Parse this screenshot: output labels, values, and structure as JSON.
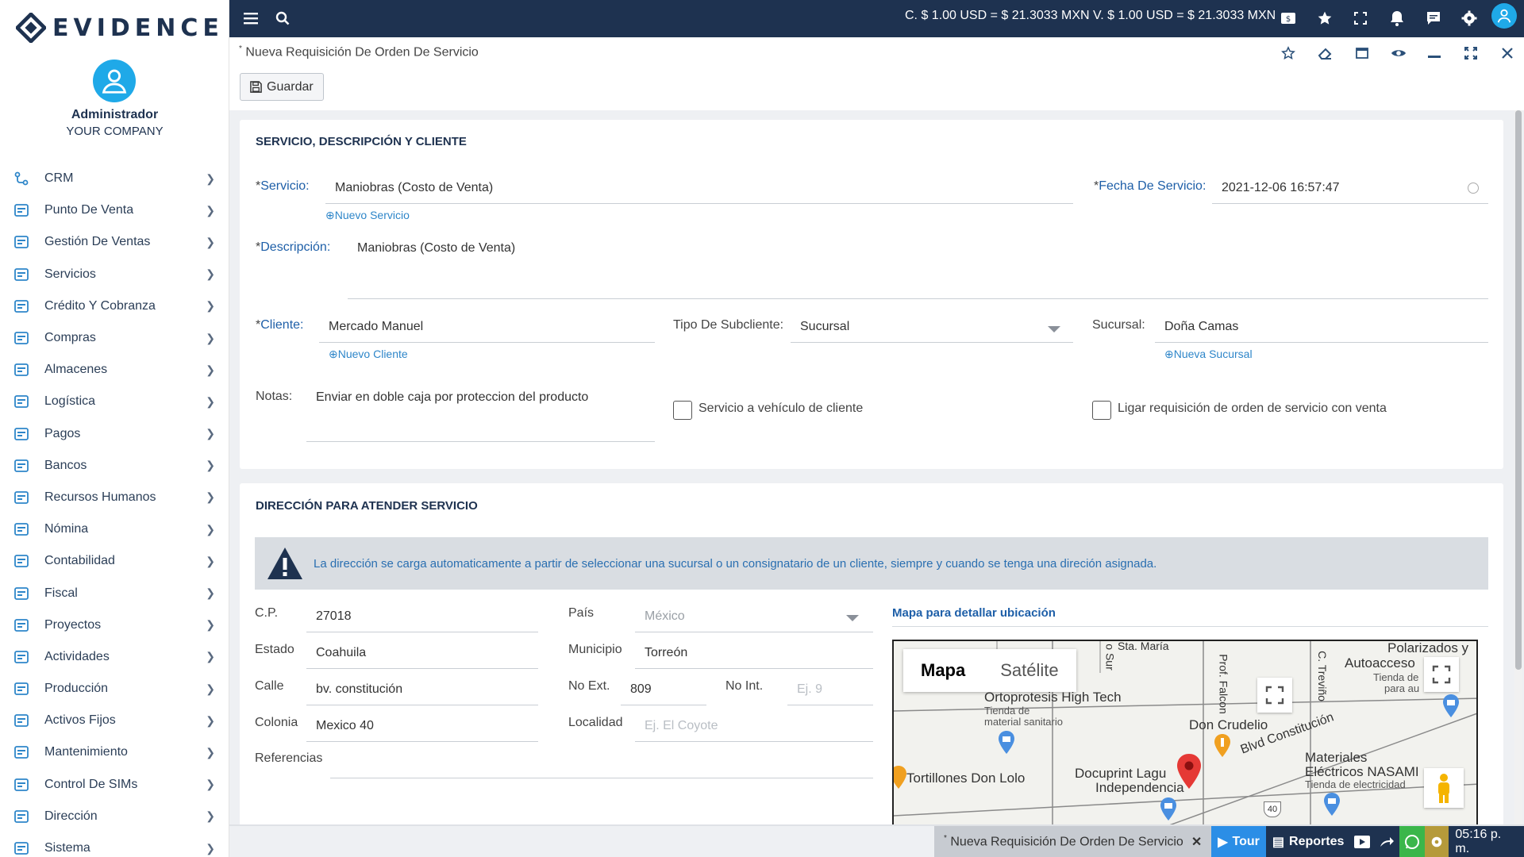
{
  "brand": {
    "name": "EVIDENCE"
  },
  "user": {
    "name": "Administrador",
    "company": "YOUR COMPANY"
  },
  "menu": [
    {
      "label": "CRM",
      "icon": "crm-icon"
    },
    {
      "label": "Punto De Venta",
      "icon": "point-of-sale-icon"
    },
    {
      "label": "Gestión De Ventas",
      "icon": "sales-management-icon"
    },
    {
      "label": "Servicios",
      "icon": "services-icon"
    },
    {
      "label": "Crédito Y Cobranza",
      "icon": "credit-icon"
    },
    {
      "label": "Compras",
      "icon": "purchases-icon"
    },
    {
      "label": "Almacenes",
      "icon": "warehouse-icon"
    },
    {
      "label": "Logística",
      "icon": "truck-icon"
    },
    {
      "label": "Pagos",
      "icon": "payments-icon"
    },
    {
      "label": "Bancos",
      "icon": "bank-icon"
    },
    {
      "label": "Recursos Humanos",
      "icon": "people-icon"
    },
    {
      "label": "Nómina",
      "icon": "payroll-icon"
    },
    {
      "label": "Contabilidad",
      "icon": "accounting-icon"
    },
    {
      "label": "Fiscal",
      "icon": "fiscal-icon"
    },
    {
      "label": "Proyectos",
      "icon": "projects-icon"
    },
    {
      "label": "Actividades",
      "icon": "activities-icon"
    },
    {
      "label": "Producción",
      "icon": "production-icon"
    },
    {
      "label": "Activos Fijos",
      "icon": "fixed-assets-icon"
    },
    {
      "label": "Mantenimiento",
      "icon": "wrench-icon"
    },
    {
      "label": "Control De SIMs",
      "icon": "location-pin-icon"
    },
    {
      "label": "Dirección",
      "icon": "direction-icon"
    },
    {
      "label": "Sistema",
      "icon": "system-icon"
    }
  ],
  "topbar": {
    "rates": "C. $ 1.00 USD = $ 21.3033 MXN   V. $ 1.00 USD = $ 21.3033 MXN"
  },
  "window": {
    "title": "Nueva Requisición De Orden De Servicio",
    "save_label": "Guardar"
  },
  "section1": {
    "title": "SERVICIO, DESCRIPCIÓN Y CLIENTE",
    "servicio_label": "Servicio:",
    "servicio_value": "Maniobras (Costo de Venta)",
    "nuevo_servicio": "Nuevo Servicio",
    "fecha_label": "Fecha De Servicio:",
    "fecha_value": "2021-12-06 16:57:47",
    "descripcion_label": "Descripción:",
    "descripcion_value": "Maniobras (Costo de Venta)",
    "cliente_label": "Cliente:",
    "cliente_value": "Mercado Manuel",
    "nuevo_cliente": "Nuevo Cliente",
    "tipo_label": "Tipo De Subcliente:",
    "tipo_value": "Sucursal",
    "sucursal_label": "Sucursal:",
    "sucursal_value": "Doña Camas",
    "nueva_sucursal": "Nueva Sucursal",
    "notas_label": "Notas:",
    "notas_value": "Enviar en doble caja por proteccion del producto",
    "check_vehiculo": "Servicio a vehículo de cliente",
    "check_vehiculo_checked": false,
    "check_ligar": "Ligar requisición de orden de servicio con venta",
    "check_ligar_checked": false
  },
  "section2": {
    "title": "DIRECCIÓN PARA ATENDER SERVICIO",
    "alert": "La dirección se carga automaticamente a partir de seleccionar una sucursal o un consignatario de un cliente, siempre y cuando se tenga una direción asignada.",
    "cp_label": "C.P.",
    "cp_value": "27018",
    "pais_label": "País",
    "pais_value": "México",
    "estado_label": "Estado",
    "estado_value": "Coahuila",
    "municipio_label": "Municipio",
    "municipio_value": "Torreón",
    "calle_label": "Calle",
    "calle_value": "bv. constitución",
    "noext_label": "No Ext.",
    "noext_value": "809",
    "noint_label": "No Int.",
    "noint_placeholder": "Ej. 9",
    "colonia_label": "Colonia",
    "colonia_value": "Mexico 40",
    "localidad_label": "Localidad",
    "localidad_placeholder": "Ej. El Coyote",
    "referencias_label": "Referencias",
    "referencias_value": ""
  },
  "map": {
    "title": "Mapa para detallar ubicación",
    "tab_map": "Mapa",
    "tab_satellite": "Satélite",
    "labels": {
      "sta_maria": "Sta. María",
      "polarizados": "Polarizados y",
      "autoaccesor": "Autoacceso",
      "tienda_de": "Tienda de",
      "para_au": "para au",
      "ortoprotesis": "Ortoprotesis High Tech",
      "tienda_material": "Tienda de",
      "material_sanitario": "material sanitario",
      "don_crudelio": "Don Crudelio",
      "blvd": "Blvd Constitución",
      "tortillones": "Tortillones Don Lolo",
      "docuprint": "Docuprint Lagu",
      "independencia": "Independencia",
      "materiales": "Materiales",
      "electricos": "Eléctricos NASAMI",
      "tienda_electricidad": "Tienda de electricidad",
      "prof_falcon": "Prof. Falcon",
      "c_trevino": "C. Treviño",
      "o_sur": "o Sur",
      "road_40": "40"
    }
  },
  "taskbar": {
    "task_title": "Nueva Requisición De Orden De Servicio",
    "tour": "Tour",
    "reportes": "Reportes",
    "time": "05:16 p. m."
  },
  "colors": {
    "navy": "#1e3250",
    "accent": "#1fa9e8",
    "label_blue": "#1e5fa8",
    "tour_blue": "#2b8ee6",
    "whatsapp_green": "#3bb64a",
    "settings_gold": "#b59a3a",
    "pin_red": "#e53935"
  }
}
